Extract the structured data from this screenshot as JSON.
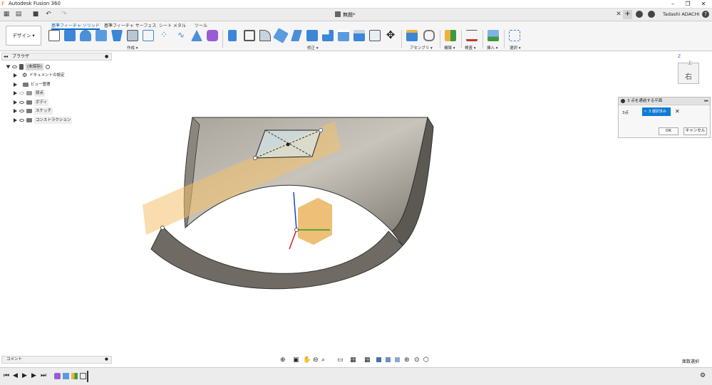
{
  "app": {
    "title": "Autodesk Fusion 360",
    "doc_title": "無題*",
    "user": "Tadashi ADACHI"
  },
  "ribbon": {
    "workspace": "デザイン ▾",
    "tabs": [
      "基準フィーチャ ソリッド",
      "基準フィーチャ サーフェス",
      "シート メタル",
      "ツール"
    ],
    "groups": [
      "作成 ▾",
      "修正 ▾",
      "アセンブリ ▾",
      "構築 ▾",
      "検査 ▾",
      "挿入 ▾",
      "選択 ▾"
    ]
  },
  "browser": {
    "title": "ブラウザ",
    "root": "(未保存)",
    "items": [
      "ドキュメントの設定",
      "ビュー管理",
      "原点",
      "ボディ",
      "スケッチ",
      "コンストラクション"
    ]
  },
  "viewcube": {
    "face": "右",
    "top": "上"
  },
  "dialog": {
    "title": "3 点を通過する平面",
    "label": "3点",
    "selected": "3 選択済み",
    "ok": "OK",
    "cancel": "キャンセル"
  },
  "comments": {
    "label": "コメント"
  },
  "status": {
    "select_mode": "面数選択"
  },
  "colors": {
    "accent": "#0a6bc4",
    "surface": "#8f8b83",
    "plane": "#f4c16c"
  }
}
